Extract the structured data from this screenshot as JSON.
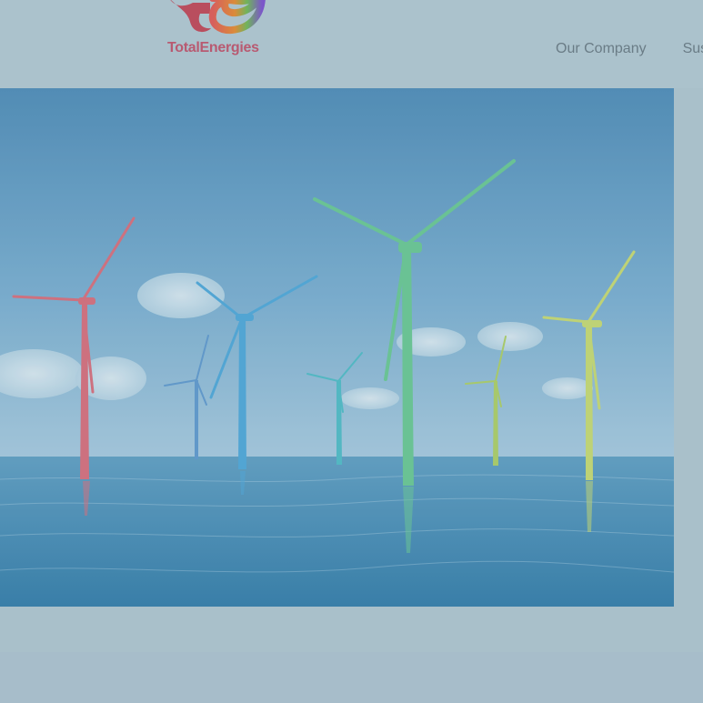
{
  "brand": {
    "name": "TotalEnergies",
    "logo_icon": "totalenergies-logo-icon"
  },
  "nav": {
    "items": [
      {
        "label": "Our Company"
      },
      {
        "label": "Sus"
      }
    ]
  },
  "hero": {
    "image": "offshore-wind-turbines-image"
  },
  "colors": {
    "overlay": "#a9c0ca",
    "brand_red": "#b85a71",
    "nav_text": "#6a7c86",
    "sky_top": "#4c88b4",
    "sea": "#3f85ad"
  }
}
